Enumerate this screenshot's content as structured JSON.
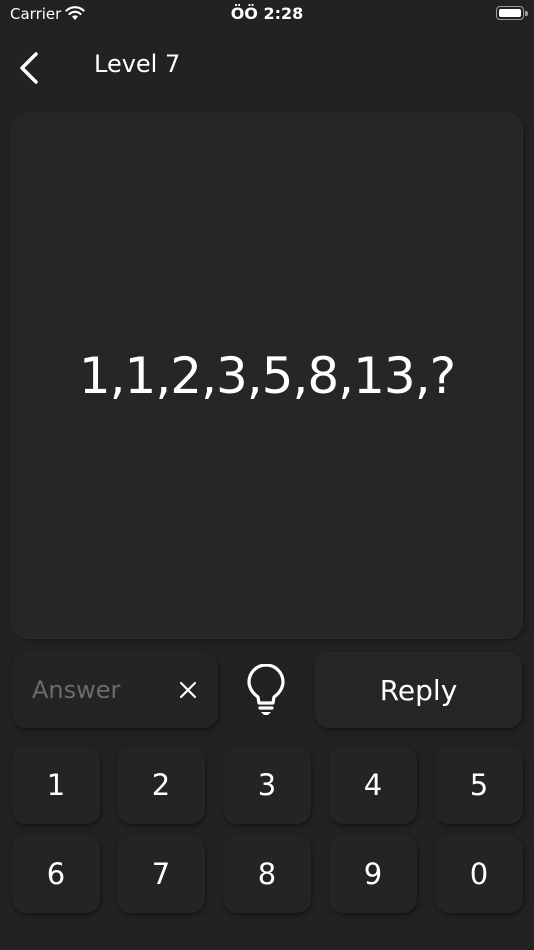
{
  "status_bar": {
    "carrier": "Carrier",
    "time": "ÖÖ 2:28"
  },
  "header": {
    "title": "Level 7"
  },
  "question": {
    "text": "1,1,2,3,5,8,13,?"
  },
  "answer": {
    "value": "",
    "placeholder": "Answer",
    "clear_label": "×"
  },
  "reply_label": "Reply",
  "keypad": [
    "1",
    "2",
    "3",
    "4",
    "5",
    "6",
    "7",
    "8",
    "9",
    "0"
  ],
  "icons": {
    "back": "chevron-left-icon",
    "clear": "close-icon",
    "hint": "lightbulb-icon",
    "wifi": "wifi-icon",
    "battery": "battery-icon"
  },
  "colors": {
    "background": "#222222",
    "card": "#262626",
    "text": "#ffffff",
    "placeholder": "#6b6b6b"
  }
}
